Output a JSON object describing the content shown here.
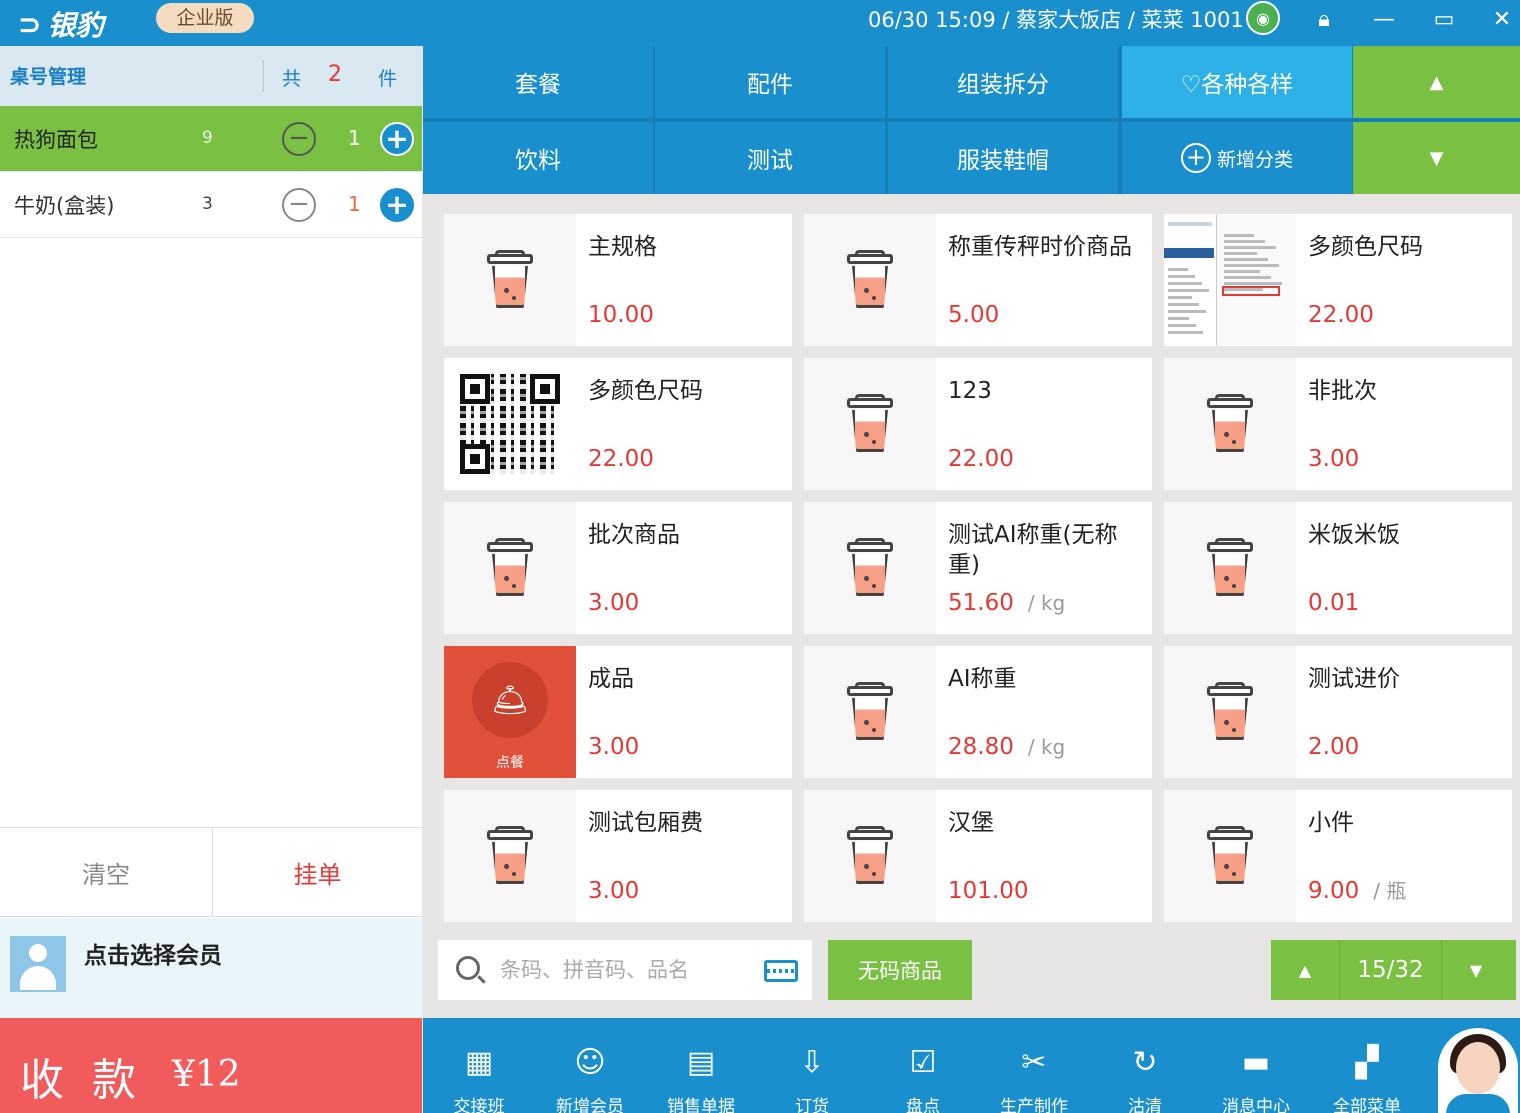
{
  "topbar": {
    "logo": "银豹",
    "edition": "企业版",
    "status": "06/30 15:09 / 蔡家大饭店 / 菜菜 1001",
    "icons": [
      "wifi-icon",
      "lock-icon",
      "minimize-icon",
      "maximize-icon",
      "close-icon"
    ]
  },
  "order": {
    "table_mgmt": "桌号管理",
    "total_prefix": "共",
    "total_count": "2",
    "total_suffix": "件",
    "items": [
      {
        "name": "热狗面包",
        "stock": "9",
        "qty": "1",
        "active": true
      },
      {
        "name": "牛奶(盒装)",
        "stock": "3",
        "qty": "1",
        "active": false
      }
    ],
    "clear_label": "清空",
    "hold_label": "挂单",
    "member_label": "点击选择会员",
    "pay_label": "收款",
    "pay_amount": "¥12"
  },
  "categories": [
    {
      "label": "套餐",
      "selected": false
    },
    {
      "label": "配件",
      "selected": false
    },
    {
      "label": "组装拆分",
      "selected": false
    },
    {
      "label": "♡各种各样",
      "selected": true
    },
    {
      "label": "饮料",
      "selected": false
    },
    {
      "label": "测试",
      "selected": false
    },
    {
      "label": "服装鞋帽",
      "selected": false
    },
    {
      "label": "新增分类",
      "selected": false
    }
  ],
  "products": [
    {
      "name": "主规格",
      "price": "10.00",
      "unit": "",
      "thumb": "cup"
    },
    {
      "name": "称重传秤时价商品",
      "price": "5.00",
      "unit": "",
      "thumb": "cup"
    },
    {
      "name": "多颜色尺码",
      "price": "22.00",
      "unit": "",
      "thumb": "screenshot"
    },
    {
      "name": "多颜色尺码",
      "price": "22.00",
      "unit": "",
      "thumb": "qr"
    },
    {
      "name": "123",
      "price": "22.00",
      "unit": "",
      "thumb": "cup"
    },
    {
      "name": "非批次",
      "price": "3.00",
      "unit": "",
      "thumb": "cup"
    },
    {
      "name": "批次商品",
      "price": "3.00",
      "unit": "",
      "thumb": "cup"
    },
    {
      "name": "测试AI称重(无称重)",
      "price": "51.60",
      "unit": "/ kg",
      "thumb": "cup"
    },
    {
      "name": "米饭米饭",
      "price": "0.01",
      "unit": "",
      "thumb": "cup"
    },
    {
      "name": "成品",
      "price": "3.00",
      "unit": "",
      "thumb": "dine",
      "thumb_label": "点餐"
    },
    {
      "name": "AI称重",
      "price": "28.80",
      "unit": "/ kg",
      "thumb": "cup"
    },
    {
      "name": "测试进价",
      "price": "2.00",
      "unit": "",
      "thumb": "cup"
    },
    {
      "name": "测试包厢费",
      "price": "3.00",
      "unit": "",
      "thumb": "cup"
    },
    {
      "name": "汉堡",
      "price": "101.00",
      "unit": "",
      "thumb": "cup"
    },
    {
      "name": "小件",
      "price": "9.00",
      "unit": "/ 瓶",
      "thumb": "cup"
    }
  ],
  "search": {
    "placeholder": "条码、拼音码、品名",
    "nocode_label": "无码商品",
    "page": "15/32"
  },
  "toolbar": [
    {
      "label": "交接班",
      "icon": "handover-icon"
    },
    {
      "label": "新增会员",
      "icon": "add-member-icon"
    },
    {
      "label": "销售单据",
      "icon": "sales-record-icon"
    },
    {
      "label": "订货",
      "icon": "order-goods-icon"
    },
    {
      "label": "盘点",
      "icon": "inventory-icon"
    },
    {
      "label": "生产制作",
      "icon": "production-icon"
    },
    {
      "label": "沽清",
      "icon": "sold-out-icon"
    },
    {
      "label": "消息中心",
      "icon": "message-icon"
    },
    {
      "label": "全部菜单",
      "icon": "all-menu-icon"
    }
  ],
  "colors": {
    "primary": "#1a8fcd",
    "accent_green": "#7ac143",
    "price_red": "#e53935",
    "pay_red": "#f25b5b"
  }
}
